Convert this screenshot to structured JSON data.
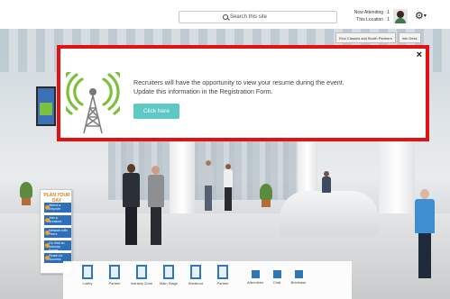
{
  "header": {
    "search_placeholder": "Search this site",
    "now_attending_label": "Now Attending",
    "now_attending_value": "1",
    "this_location_label": "This Location",
    "this_location_value": "1",
    "settings_icon": "gear-icon",
    "settings_caret": "▾"
  },
  "scene_tools": [
    {
      "label": "Find Classes and Booth Partners"
    },
    {
      "label": "Info Desk"
    }
  ],
  "plan_board": {
    "title": "PLAN YOUR DAY",
    "items": [
      "Attend a Keynote",
      "Join a Breakout",
      "Network with Peers",
      "Go Visit an Industry Expert",
      "Reach for Success"
    ]
  },
  "bottom_nav": [
    {
      "label": "Lobby",
      "icon": "lobby-icon"
    },
    {
      "label": "Partner",
      "icon": "partner-icon"
    },
    {
      "label": "Industry Zone",
      "icon": "industry-zone-icon"
    },
    {
      "label": "Main Stage",
      "icon": "main-stage-icon"
    },
    {
      "label": "Breakout",
      "icon": "breakout-icon"
    },
    {
      "label": "Partner",
      "icon": "partner-booth-icon"
    },
    {
      "label": "Attendees",
      "icon": "attendees-icon"
    },
    {
      "label": "Chat",
      "icon": "chat-icon"
    },
    {
      "label": "Briefcase",
      "icon": "briefcase-icon"
    }
  ],
  "modal": {
    "message_line1": "Recruiters will have the opportunity to view your resume during the event.",
    "message_line2": "Update this information in the Registration Form.",
    "cta_label": "Click here",
    "close_label": "×",
    "icon": "broadcast-tower-icon",
    "border_color": "#e31212",
    "cta_color": "#5ec8c4"
  }
}
